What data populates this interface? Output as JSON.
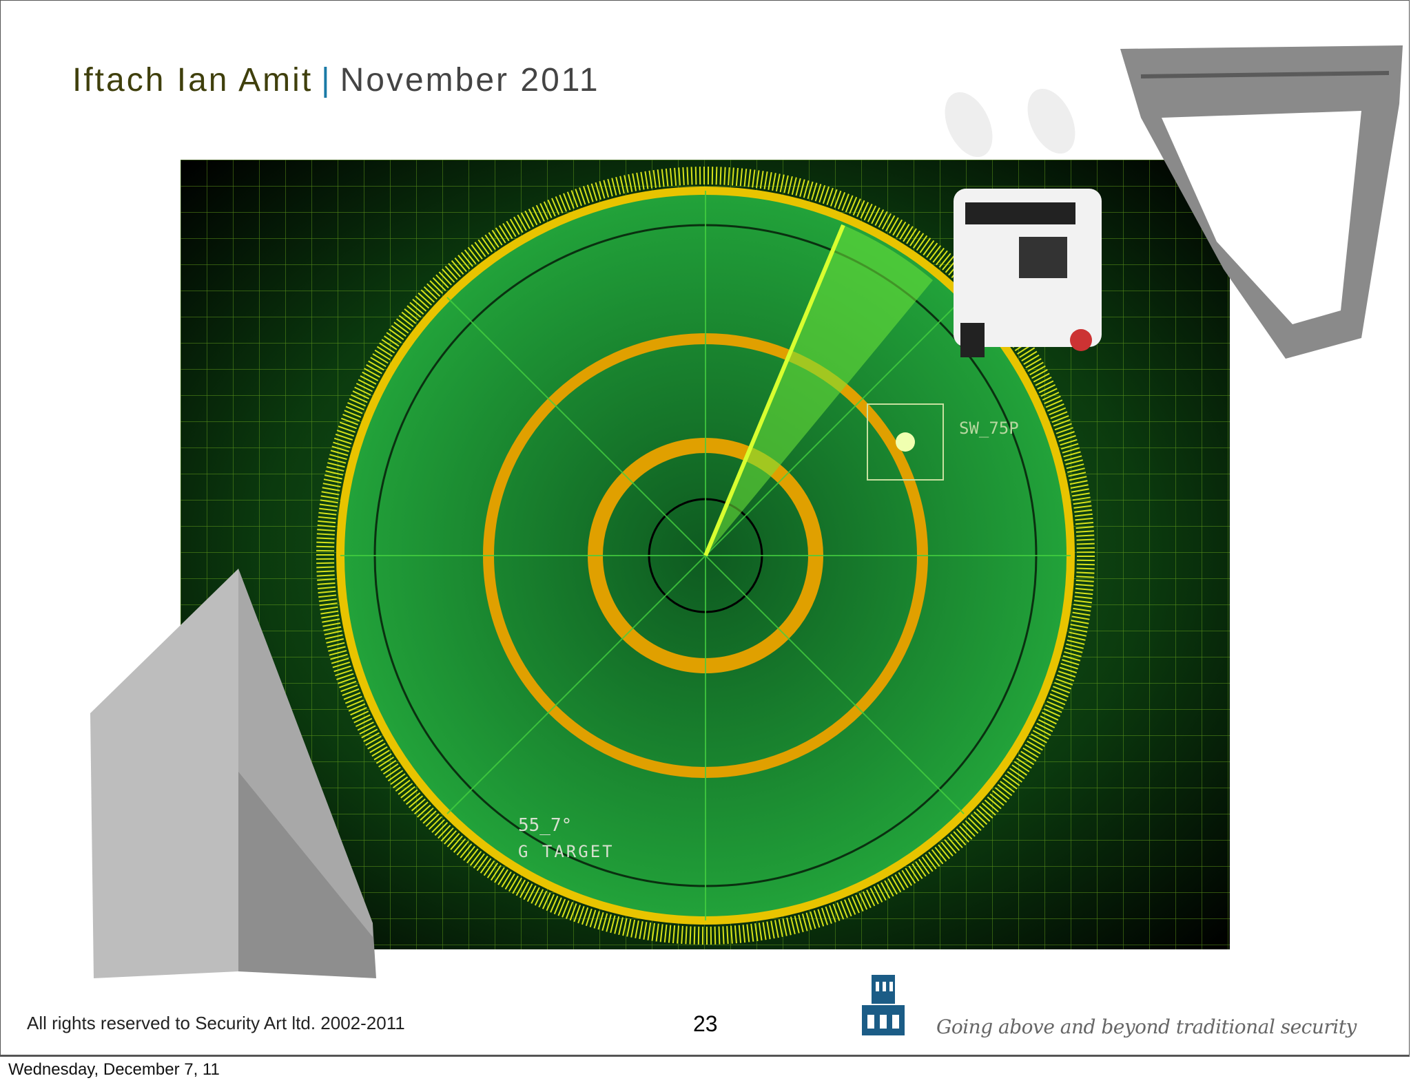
{
  "header": {
    "author": "Iftach Ian Amit",
    "separator": "|",
    "date": "November 2011"
  },
  "radar": {
    "label_bearing": "55_7°",
    "label_target": "G TARGET",
    "label_code": "SW_75P"
  },
  "footer": {
    "copyright": "All rights reserved to Security Art ltd. 2002-2011",
    "page_number": "23",
    "tagline": "Going above and beyond traditional security",
    "print_date": "Wednesday, December 7, 11"
  },
  "colors": {
    "author": "#3f3f0c",
    "separator": "#1a7aa6",
    "radar_green": "#1f8a2e",
    "ring_orange": "#e0a000",
    "logo_blue": "#1b5c86"
  }
}
